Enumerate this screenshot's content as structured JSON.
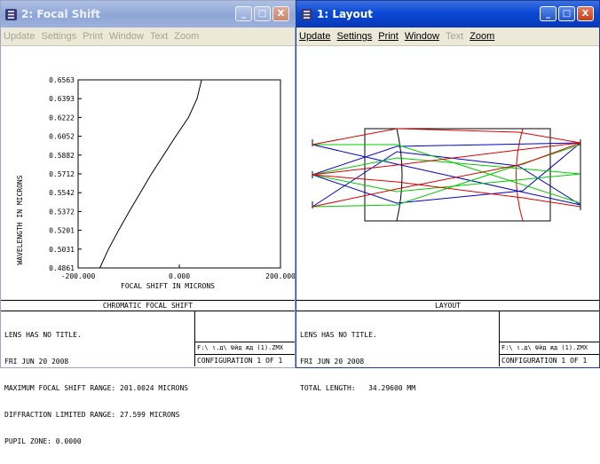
{
  "left_window": {
    "title": "2: Focal Shift",
    "active": false,
    "menu": [
      {
        "label": "Update",
        "enabled": false
      },
      {
        "label": "Settings",
        "enabled": false
      },
      {
        "label": "Print",
        "enabled": false
      },
      {
        "label": "Window",
        "enabled": false
      },
      {
        "label": "Text",
        "enabled": false
      },
      {
        "label": "Zoom",
        "enabled": false
      }
    ],
    "panel": {
      "title": "CHROMATIC FOCAL SHIFT",
      "lines": [
        "LENS HAS NO TITLE.",
        "FRI JUN 20 2008",
        "MAXIMUM FOCAL SHIFT RANGE: 201.0024 MICRONS",
        "DIFFRACTION LIMITED RANGE: 27.599 MICRONS",
        "PUPIL ZONE: 0.0000"
      ],
      "file_path": "F:\\ ι.д\\ ѿйд ѫд (1).ZMX",
      "configuration": "CONFIGURATION 1 OF 1"
    }
  },
  "right_window": {
    "title": "1: Layout",
    "active": true,
    "menu": [
      {
        "label": "Update",
        "enabled": true
      },
      {
        "label": "Settings",
        "enabled": true
      },
      {
        "label": "Print",
        "enabled": true
      },
      {
        "label": "Window",
        "enabled": true
      },
      {
        "label": "Text",
        "enabled": false
      },
      {
        "label": "Zoom",
        "enabled": true
      }
    ],
    "panel": {
      "title": "LAYOUT",
      "lines": [
        "LENS HAS NO TITLE.",
        "FRI JUN 20 2008",
        "TOTAL LENGTH:   34.29600 MM"
      ],
      "file_path": "F:\\ ι.д\\ ѿйд ѫд (1).ZMX",
      "configuration": "CONFIGURATION 1 OF 1"
    }
  },
  "window_buttons": {
    "minimize": "_",
    "maximize": "□",
    "close": "X"
  },
  "chart_data": {
    "type": "line",
    "title": "",
    "xlabel": "FOCAL SHIFT IN MICRONS",
    "ylabel": "WAVELENGTH IN MICRONS",
    "xlim": [
      -200,
      200
    ],
    "ylim": [
      0.4861,
      0.6563
    ],
    "x_tick_labels": [
      "-200.000",
      "0.000",
      "200.000"
    ],
    "x_ticks": [
      -200,
      0,
      200
    ],
    "y_tick_labels": [
      "0.4861",
      "0.5031",
      "0.5201",
      "0.5372",
      "0.5542",
      "0.5712",
      "0.5882",
      "0.6052",
      "0.6222",
      "0.6393",
      "0.6563"
    ],
    "series": [
      {
        "color": "#000000",
        "x": [
          -157,
          -140,
          -120,
          -99,
          -77,
          -55,
          -31,
          -7,
          18,
          35,
          44
        ],
        "y": [
          0.4861,
          0.5031,
          0.5201,
          0.5372,
          0.5542,
          0.5712,
          0.5882,
          0.6052,
          0.6222,
          0.6393,
          0.6563
        ]
      }
    ]
  },
  "layout_colors": {
    "field_1": "#0000cc",
    "field_2": "#00cc00",
    "field_3": "#dd0000",
    "lens": "#000000"
  }
}
